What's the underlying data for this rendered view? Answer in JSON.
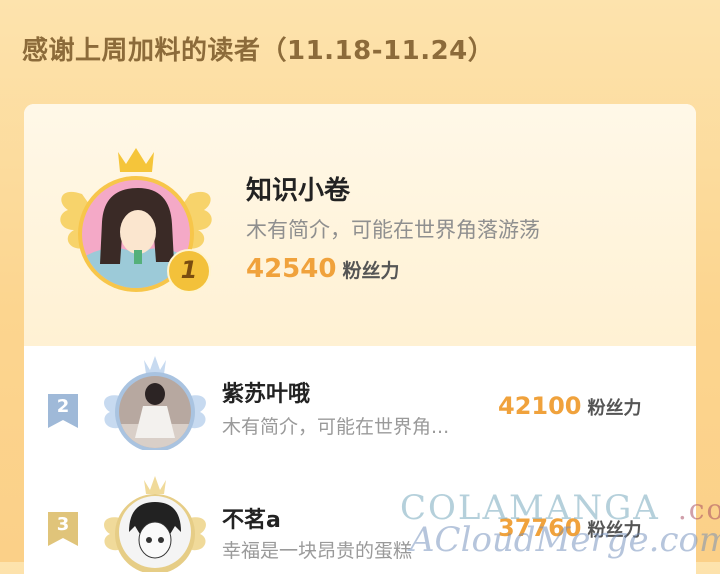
{
  "header": {
    "title": "感谢上周加料的读者（11.18-11.24）"
  },
  "colors": {
    "accent": "#f0a23c",
    "background": "#fcd58f",
    "gold": "#f7c64a",
    "silver": "#9fb9d8",
    "bronze": "#e0c47a"
  },
  "top_reader": {
    "rank": "1",
    "name": "知识小卷",
    "bio": "木有简介，可能在世界角落游荡",
    "fans_count": "42540",
    "fans_label": "粉丝力"
  },
  "readers": [
    {
      "rank": "2",
      "name": "紫苏叶哦",
      "bio": "木有简介，可能在世界角...",
      "fans_count": "42100",
      "fans_label": "粉丝力"
    },
    {
      "rank": "3",
      "name": "不茗a",
      "bio": "幸福是一块昂贵的蛋糕",
      "fans_count": "37760",
      "fans_label": "粉丝力"
    }
  ],
  "watermark": {
    "line1": "COLAMANGA",
    "line1_suffix": ".com",
    "line2": "ACloudMerge.com"
  }
}
